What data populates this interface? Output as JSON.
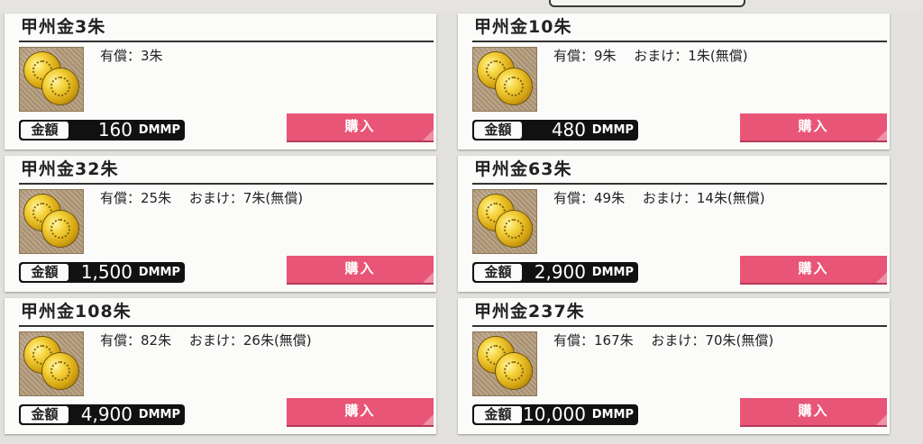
{
  "buy_label": "購入",
  "price_label": "金額",
  "currency": "DMMP",
  "products": [
    {
      "title": "甲州金3朱",
      "details": "有償：3朱",
      "price": "160"
    },
    {
      "title": "甲州金10朱",
      "details": "有償：9朱　 おまけ：1朱(無償)",
      "price": "480"
    },
    {
      "title": "甲州金32朱",
      "details": "有償：25朱　 おまけ：7朱(無償)",
      "price": "1,500"
    },
    {
      "title": "甲州金63朱",
      "details": "有償：49朱　 おまけ：14朱(無償)",
      "price": "2,900"
    },
    {
      "title": "甲州金108朱",
      "details": "有償：82朱　 おまけ：26朱(無償)",
      "price": "4,900"
    },
    {
      "title": "甲州金237朱",
      "details": "有償：167朱　 おまけ：70朱(無償)",
      "price": "10,000"
    }
  ],
  "colors": {
    "buy_button": "#e85577",
    "price_box": "#111111",
    "background": "#e3e1de",
    "card": "#fbfbfa"
  },
  "icons": {
    "product_image": "gold-coins-icon"
  }
}
